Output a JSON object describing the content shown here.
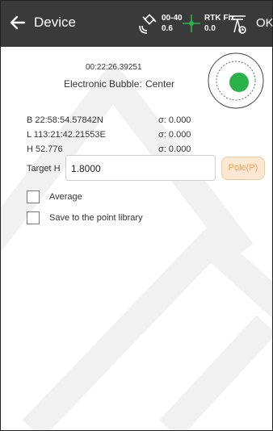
{
  "header": {
    "title": "Device",
    "satellites": {
      "top": "00-40",
      "bottom": "0.6"
    },
    "fix": {
      "status": "RTK Fix",
      "age": "0.0"
    },
    "ok_label": "OK"
  },
  "status": {
    "time": "00:22:26.39251",
    "bubble_label": "Electronic Bubble:",
    "bubble_value": "Center"
  },
  "coordinates": [
    {
      "label": "B 22:58:54.57842N",
      "sigma": "σ: 0.000"
    },
    {
      "label": "L 113:21:42.21553E",
      "sigma": "σ: 0.000"
    },
    {
      "label": "H 52.776",
      "sigma": "σ: 0.000"
    }
  ],
  "target": {
    "label": "Target H",
    "value": "1.8000",
    "pole_button": "Pole(P)"
  },
  "options": [
    {
      "label": "Average",
      "checked": false
    },
    {
      "label": "Save to the point library",
      "checked": false
    }
  ],
  "colors": {
    "header_bg": "#3a3a3a",
    "bubble_green": "#2bb34a",
    "pole_orange": "#f5a04a"
  }
}
